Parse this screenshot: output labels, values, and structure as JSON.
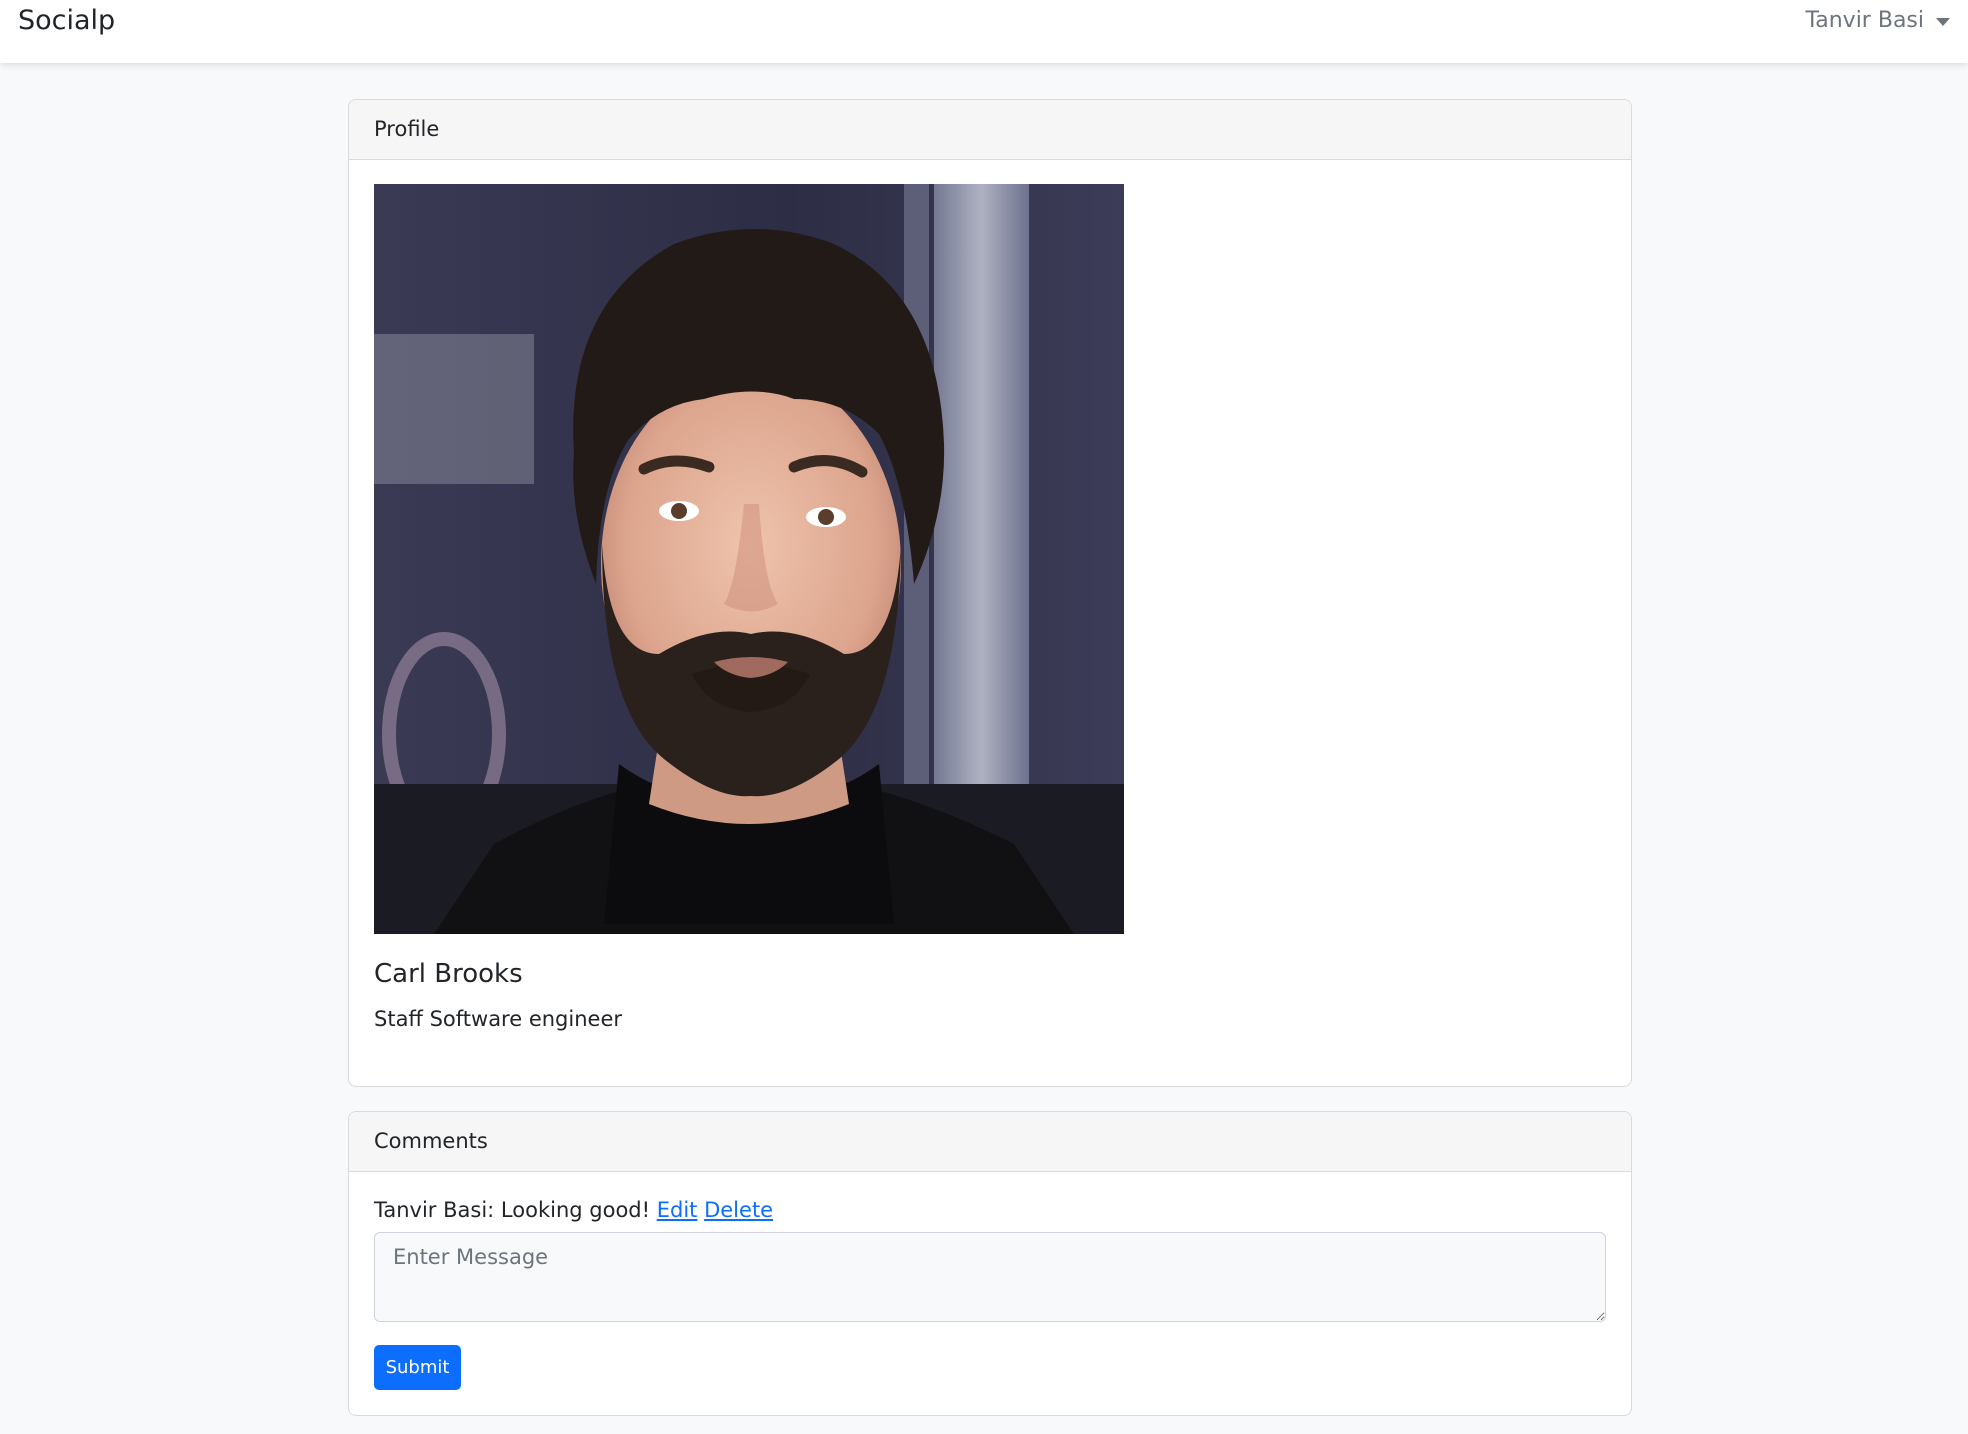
{
  "navbar": {
    "brand": "Socialp",
    "user_name": "Tanvir Basi"
  },
  "profile_card": {
    "header": "Profile",
    "photo_alt": "Profile photo",
    "name": "Carl Brooks",
    "job_title": "Staff Software engineer"
  },
  "comments_card": {
    "header": "Comments",
    "comments": [
      {
        "author": "Tanvir Basi",
        "separator": ": ",
        "text": "Looking good!",
        "edit_label": "Edit",
        "delete_label": "Delete"
      }
    ],
    "message_placeholder": "Enter Message",
    "submit_label": "Submit"
  },
  "colors": {
    "primary": "#0d6efd",
    "page_background": "#f8f9fa",
    "card_header_background": "#f6f6f6"
  }
}
